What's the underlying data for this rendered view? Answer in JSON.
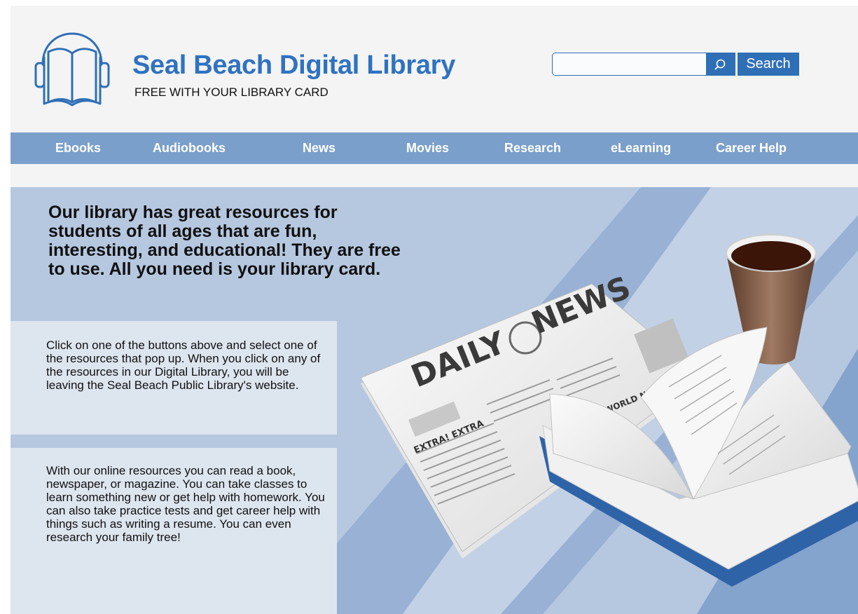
{
  "header": {
    "title": "Seal Beach Digital Library",
    "tagline": "FREE WITH YOUR LIBRARY CARD",
    "search": {
      "placeholder": "",
      "button_label": "Search"
    }
  },
  "nav": {
    "items": [
      {
        "label": "Ebooks"
      },
      {
        "label": "Audiobooks"
      },
      {
        "label": "News"
      },
      {
        "label": "Movies"
      },
      {
        "label": "Research"
      },
      {
        "label": "eLearning"
      },
      {
        "label": "Career Help"
      }
    ]
  },
  "hero": {
    "heading": "Our library has great resources for students of all ages that are fun, interesting, and educational! They are free to use. All you need is your library card.",
    "panel1": "Click on one of the buttons above and select one of the resources that pop up. When you click on any of the resources in our Digital Library, you will be leaving the Seal Beach Public Library's website.",
    "panel2": "With our online resources you can read a book, newspaper, or magazine. You can take classes to learn something new or get help with homework. You can also take practice tests and get career help with things such as writing a resume. You can even research your family tree!"
  },
  "illustration": {
    "newspaper_masthead_left": "DAILY",
    "newspaper_masthead_right": "NEWS",
    "newspaper_headline": "EXTRA! EXTRA",
    "newspaper_subhead": "WORLD NEWS"
  },
  "colors": {
    "brand_blue": "#2f72c0",
    "nav_blue": "#7a9fcb",
    "hero_blue": "#b6c8e0",
    "panel": "#dde5ef"
  }
}
